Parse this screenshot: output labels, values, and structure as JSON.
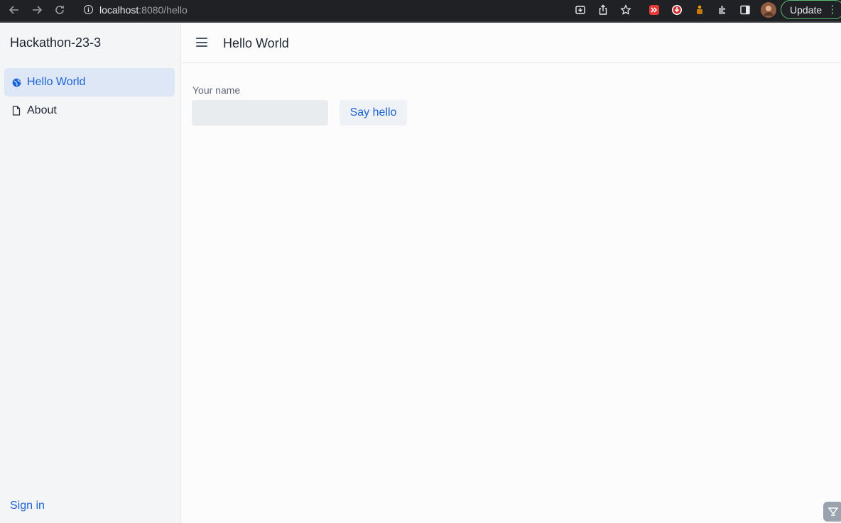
{
  "browser": {
    "url_host": "localhost",
    "url_rest": ":8080/hello",
    "update_label": "Update",
    "icons": [
      "back-arrow-icon",
      "forward-arrow-icon",
      "reload-icon",
      "site-info-icon",
      "install-icon",
      "share-icon",
      "star-icon",
      "extension-red-icon",
      "extension-download-icon",
      "extension-puzzle-icon",
      "sidepanel-icon",
      "profile-avatar"
    ]
  },
  "sidebar": {
    "app_title": "Hackathon-23-3",
    "items": [
      {
        "label": "Hello World",
        "icon": "globe-icon",
        "active": true
      },
      {
        "label": "About",
        "icon": "file-icon",
        "active": false
      }
    ],
    "signin_label": "Sign in"
  },
  "main": {
    "title": "Hello World",
    "form": {
      "name_label": "Your name",
      "name_value": "",
      "button_label": "Say hello"
    }
  },
  "colors": {
    "accent": "#1a62d6",
    "active_bg": "#dde7f5",
    "sidebar_bg": "#f4f5f7",
    "chrome_bg": "#202124"
  }
}
